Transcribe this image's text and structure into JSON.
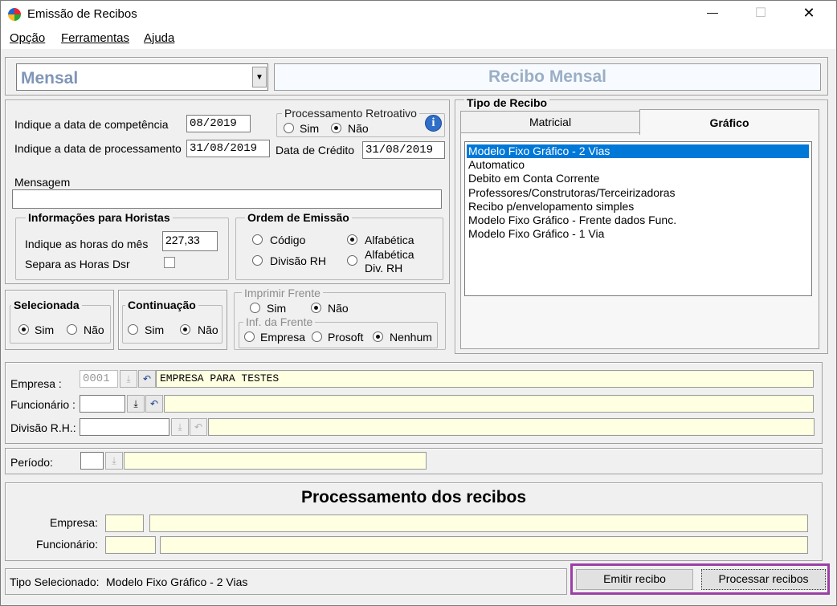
{
  "window": {
    "title": "Emissão de Recibos",
    "minimize_glyph": "—",
    "maximize_glyph": "☐",
    "close_glyph": "✕"
  },
  "menu": [
    {
      "label": "Opção"
    },
    {
      "label": "Ferramentas"
    },
    {
      "label": "Ajuda"
    }
  ],
  "tipo_select": {
    "value": "Mensal"
  },
  "banner": {
    "text": "Recibo Mensal"
  },
  "datas": {
    "competencia_label": "Indique a data de competência",
    "competencia_value": "08/2019",
    "processamento_label": "Indique a data de processamento",
    "processamento_value": "31/08/2019",
    "credito_label": "Data de Crédito",
    "credito_value": "31/08/2019"
  },
  "retroativo": {
    "title": "Processamento Retroativo",
    "sim": "Sim",
    "nao": "Não",
    "info_glyph": "i"
  },
  "mensagem": {
    "label": "Mensagem",
    "value": ""
  },
  "horistas": {
    "title": "Informações para Horistas",
    "horas_label": "Indique as horas do mês",
    "horas_value": "227,33",
    "dsr_label": "Separa as Horas Dsr"
  },
  "ordem": {
    "title": "Ordem de Emissão",
    "codigo": "Código",
    "alfabetica": "Alfabética",
    "divisao": "Divisão RH",
    "alfa_div_1": "Alfabética",
    "alfa_div_2": "Div.  RH"
  },
  "selecionada": {
    "title": "Selecionada",
    "sim": "Sim",
    "nao": "Não"
  },
  "continuacao": {
    "title": "Continuação",
    "sim": "Sim",
    "nao": "Não"
  },
  "imprimir_frente": {
    "title": "Imprimir Frente",
    "sim": "Sim",
    "nao": "Não"
  },
  "inf_frente": {
    "title": "Inf. da Frente",
    "empresa": "Empresa",
    "prosoft": "Prosoft",
    "nenhum": "Nenhum"
  },
  "tipo_recibo": {
    "title": "Tipo de Recibo",
    "tabs": [
      {
        "label": "Matricial"
      },
      {
        "label": "Gráfico"
      }
    ],
    "items": [
      "Modelo Fixo Gráfico - 2 Vias",
      "Automatico",
      "Debito em Conta Corrente",
      "Professores/Construtoras/Terceirizadoras",
      "Recibo p/envelopamento simples",
      "Modelo Fixo Gráfico - Frente dados Func.",
      "Modelo Fixo Gráfico - 1 Via"
    ]
  },
  "filtros": {
    "empresa_label": "Empresa :",
    "empresa_code": "0001",
    "empresa_name": "EMPRESA PARA TESTES",
    "funcionario_label": "Funcionário :",
    "divisao_label": "Divisão R.H.:",
    "periodo_label": "Período:",
    "download_glyph": "⤓",
    "undo_glyph": "↶"
  },
  "processamento": {
    "title": "Processamento dos recibos",
    "empresa_label": "Empresa:",
    "funcionario_label": "Funcionário:"
  },
  "status": {
    "label": "Tipo Selecionado:",
    "value": "Modelo Fixo Gráfico - 2 Vias"
  },
  "buttons": {
    "emitir": "Emitir recibo",
    "processar": "Processar recibos"
  },
  "colors": {
    "highlight_border": "#9b3fa6",
    "selection": "#0078d7",
    "banner_text": "#9aaec6",
    "select_text": "#7f95b8"
  }
}
